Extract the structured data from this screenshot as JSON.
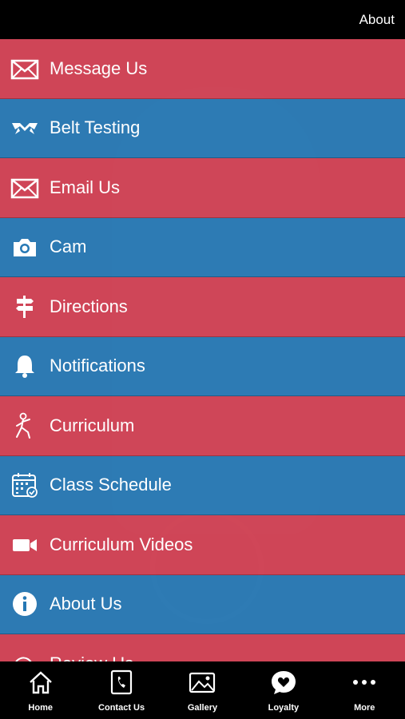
{
  "header": {
    "about_label": "About"
  },
  "menu": {
    "items": [
      {
        "label": "Message Us",
        "icon": "envelope-icon",
        "color": "red"
      },
      {
        "label": "Belt Testing",
        "icon": "belt-icon",
        "color": "blue"
      },
      {
        "label": "Email Us",
        "icon": "envelope-icon",
        "color": "red"
      },
      {
        "label": "Cam",
        "icon": "camera-icon",
        "color": "blue"
      },
      {
        "label": "Directions",
        "icon": "signpost-icon",
        "color": "red"
      },
      {
        "label": "Notifications",
        "icon": "bell-icon",
        "color": "blue"
      },
      {
        "label": "Curriculum",
        "icon": "karate-figure-icon",
        "color": "red"
      },
      {
        "label": "Class Schedule",
        "icon": "calendar-icon",
        "color": "blue"
      },
      {
        "label": "Curriculum Videos",
        "icon": "video-camera-icon",
        "color": "red"
      },
      {
        "label": "About Us",
        "icon": "info-icon",
        "color": "blue"
      },
      {
        "label": "Review Us",
        "icon": "review-icon",
        "color": "red"
      }
    ]
  },
  "tabs": [
    {
      "label": "Home",
      "icon": "home-icon"
    },
    {
      "label": "Contact Us",
      "icon": "phone-icon"
    },
    {
      "label": "Gallery",
      "icon": "gallery-icon"
    },
    {
      "label": "Loyalty",
      "icon": "heart-bubble-icon"
    },
    {
      "label": "More",
      "icon": "more-dots-icon"
    }
  ],
  "colors": {
    "red": "#d63f50",
    "blue": "#2678b4",
    "bar": "#000000"
  }
}
